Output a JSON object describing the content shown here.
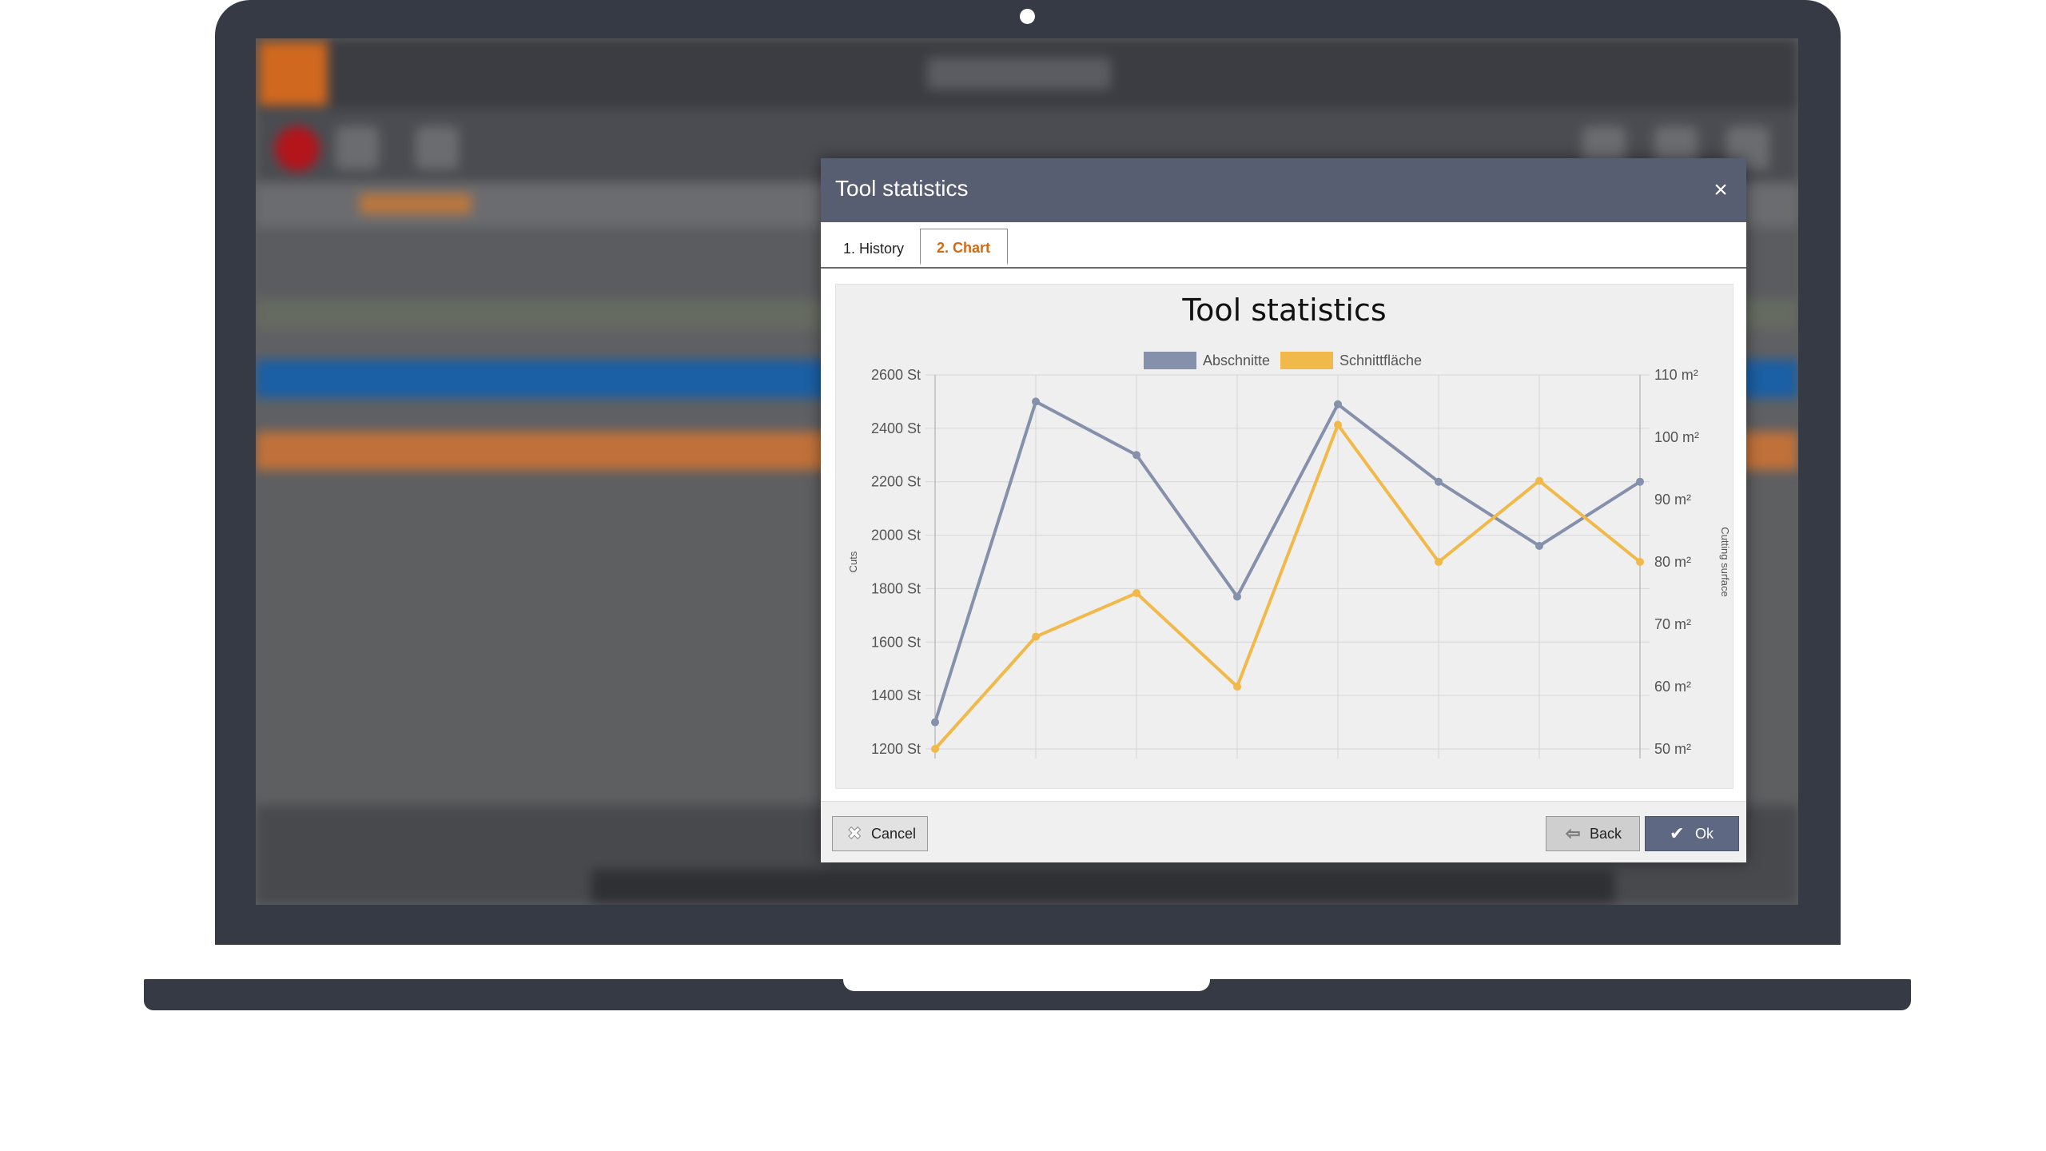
{
  "dialog": {
    "title": "Tool statistics",
    "close_label": "×"
  },
  "tabs": [
    {
      "label": "1. History",
      "active": false
    },
    {
      "label": "2. Chart",
      "active": true
    }
  ],
  "buttons": {
    "cancel": "Cancel",
    "back": "Back",
    "ok": "Ok"
  },
  "colors": {
    "titlebar": "#575e72",
    "active_tab": "#d26a14",
    "series_cuts": "#8590ab",
    "series_surface": "#f0b94a",
    "ok_button": "#5e6882"
  },
  "icons": {
    "close": "close-icon",
    "cancel": "x-icon",
    "back": "arrow-left-icon",
    "ok": "checkmark-icon"
  },
  "chart_data": {
    "type": "line",
    "title": "Tool statistics",
    "legend_position": "top",
    "grid": true,
    "x": [
      1,
      2,
      3,
      4,
      5,
      6,
      7,
      8
    ],
    "series": [
      {
        "name": "Abschnitte",
        "axis": "left",
        "values": [
          1300,
          2500,
          2300,
          1770,
          2490,
          2200,
          1960,
          2200
        ]
      },
      {
        "name": "Schnittfläche",
        "axis": "right",
        "values": [
          50,
          68,
          75,
          60,
          102,
          80,
          93,
          80
        ]
      }
    ],
    "y_left": {
      "label": "Cuts",
      "range": [
        1200,
        2600
      ],
      "ticks": [
        "2600 St",
        "2400 St",
        "2200 St",
        "2000 St",
        "1800 St",
        "1600 St",
        "1400 St",
        "1200 St"
      ]
    },
    "y_right": {
      "label": "Cutting surface",
      "range": [
        50,
        110
      ],
      "ticks": [
        "110 m²",
        "100 m²",
        "90 m²",
        "80 m²",
        "70 m²",
        "60 m²",
        "50 m²"
      ]
    }
  }
}
